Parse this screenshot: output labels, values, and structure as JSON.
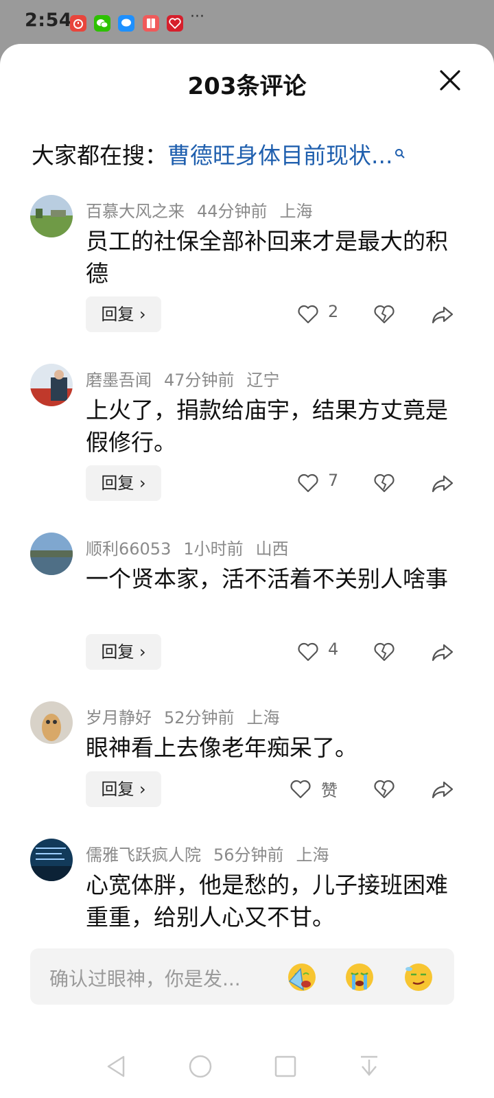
{
  "status_bar": {
    "time": "2:54",
    "more": "···",
    "notification_icons": [
      "alarm-app-icon",
      "wechat-icon",
      "message-app-icon",
      "reader-app-icon",
      "heart-app-icon"
    ]
  },
  "sheet": {
    "title": "203条评论",
    "search_label": "大家都在搜：",
    "search_link": "曹德旺身体目前现状..."
  },
  "comments": [
    {
      "user": "百慕大风之来",
      "time": "44分钟前",
      "location": "上海",
      "text": "员工的社保全部补回来才是最大的积德",
      "reply": "回复 ›",
      "likes": "2"
    },
    {
      "user": "磨墨吾闻",
      "time": "47分钟前",
      "location": "辽宁",
      "text": "上火了，捐款给庙宇，结果方丈竟是假修行。",
      "reply": "回复 ›",
      "likes": "7"
    },
    {
      "user": "顺利66053",
      "time": "1小时前",
      "location": "山西",
      "text": "一个贤本家，活不活着不关别人啥事",
      "reply": "回复 ›",
      "likes": "4"
    },
    {
      "user": "岁月静好",
      "time": "52分钟前",
      "location": "上海",
      "text": "眼神看上去像老年痴呆了。",
      "reply": "回复 ›",
      "likes": "赞"
    },
    {
      "user": "儒雅飞跃疯人院",
      "time": "56分钟前",
      "location": "上海",
      "text": "心宽体胖，他是愁的，儿子接班困难重重，给别人心又不甘。"
    }
  ],
  "input": {
    "placeholder": "确认过眼神，你是发...",
    "emojis": [
      "crying-fan-emoji",
      "crying-emoji",
      "smirk-emoji"
    ]
  },
  "nav": [
    "back-icon",
    "home-icon",
    "recents-icon",
    "notification-shade-icon"
  ],
  "colors": {
    "link": "#1f5fae",
    "meta": "#8a8a8a",
    "reply_bg": "#f2f2f2"
  }
}
